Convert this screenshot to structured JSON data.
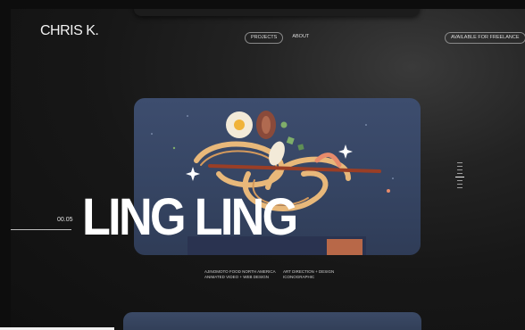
{
  "header": {
    "logo": "CHRIS K.",
    "nav": [
      {
        "label": "PROJECTS"
      },
      {
        "label": "ABOUT"
      }
    ],
    "availability": "AVAILABLE FOR FREELANCE"
  },
  "project": {
    "counter": "00.05",
    "title": "LING LING",
    "client": "AJINOMOTO FOOD NORTH AMERICA",
    "deliverables": "ANIMATED VIDEO + WEB DESIGN",
    "role": "ART DIRECTION + DESIGN",
    "partner": "ICONOGRAPHIC"
  },
  "colors": {
    "background": "#0d0d0d",
    "card": "#3d4d6e",
    "noodle": "#e8b87a",
    "accent": "#b86848"
  }
}
